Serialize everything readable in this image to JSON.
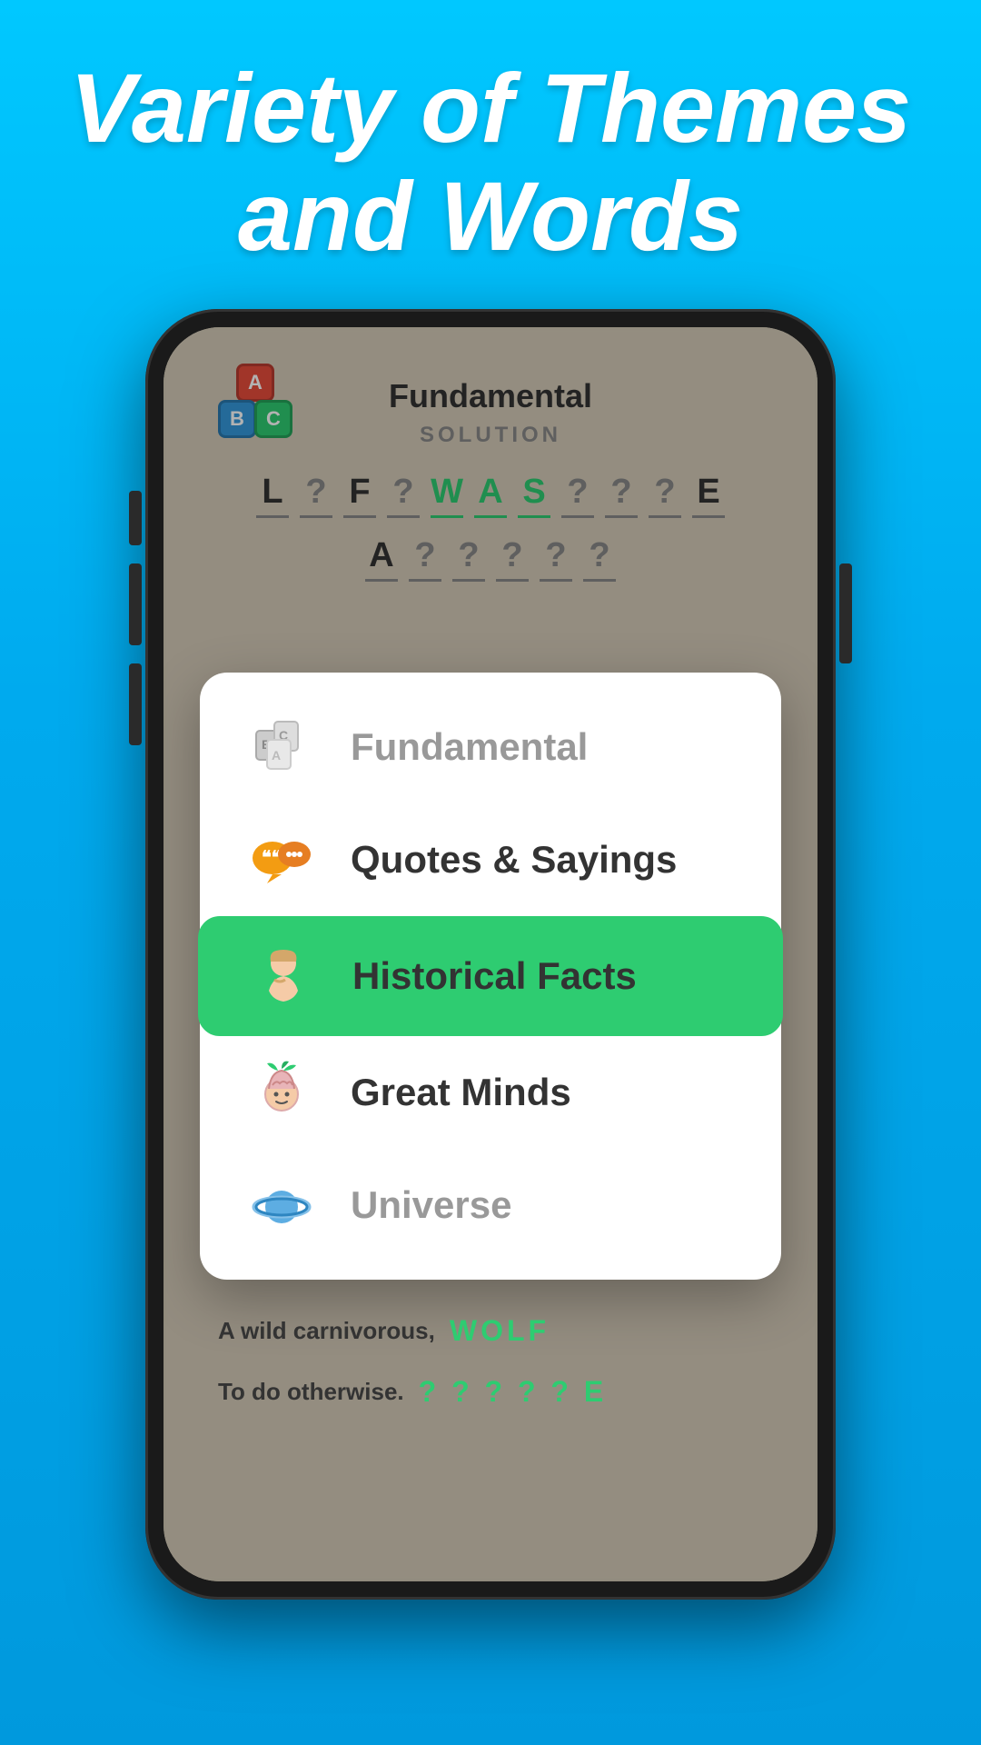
{
  "header": {
    "title": "Variety of Themes and Words"
  },
  "phone": {
    "app_title": "Fundamental",
    "solution_label": "SOLUTION",
    "logo_letters": {
      "a": "A",
      "b": "B",
      "c": "C"
    },
    "puzzle_row1": [
      "L",
      "?",
      "F",
      "?",
      "W",
      "A",
      "S",
      "?",
      "?",
      "?",
      "E"
    ],
    "puzzle_row2": [
      "A",
      "?",
      "?",
      "?",
      "?",
      "?"
    ],
    "bottom_clue1": "A wild carnivorous,",
    "bottom_answer1": "WOLF",
    "bottom_clue2": "To do otherwise.",
    "bottom_answer2": "? ? ? ? ? E"
  },
  "menu": {
    "items": [
      {
        "id": "fundamental",
        "label": "Fundamental",
        "muted": true,
        "selected": false
      },
      {
        "id": "quotes-sayings",
        "label": "Quotes & Sayings",
        "muted": false,
        "selected": false
      },
      {
        "id": "historical-facts",
        "label": "Historical Facts",
        "muted": false,
        "selected": true
      },
      {
        "id": "great-minds",
        "label": "Great Minds",
        "muted": false,
        "selected": false
      },
      {
        "id": "universe",
        "label": "Universe",
        "muted": true,
        "selected": false
      }
    ]
  },
  "colors": {
    "background": "#00bfff",
    "selected": "#2ecc71",
    "text_dark": "#333333",
    "text_muted": "#999999",
    "green": "#2ecc71"
  }
}
